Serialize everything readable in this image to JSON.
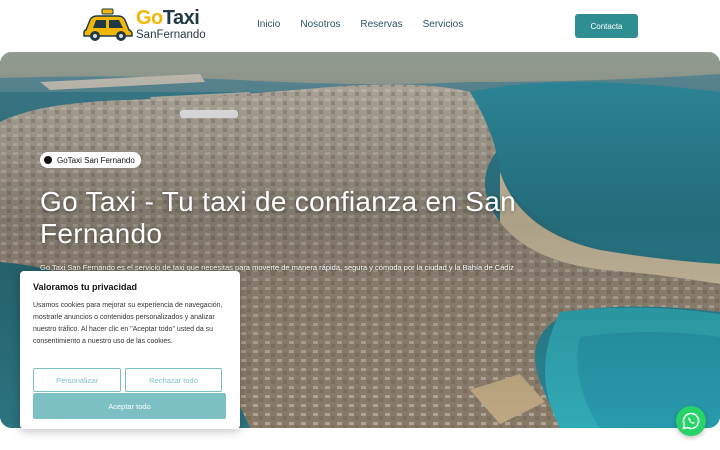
{
  "brand": {
    "go": "Go",
    "taxi": "Taxi",
    "city": "SanFernando",
    "colors": {
      "accent": "#2e8e91",
      "yellow": "#f2b705",
      "dark": "#1f3a45"
    }
  },
  "nav": {
    "items": [
      "Inicio",
      "Nosotros",
      "Reservas",
      "Servicios"
    ],
    "contact_label": "Contacta"
  },
  "hero": {
    "badge": "GoTaxi San Fernando",
    "title": "Go Taxi - Tu taxi de confianza en San Fernando",
    "subtitle": "Go Taxi San Fernando es el servicio de taxi que necesitas para moverte de manera rápida, segura y cómoda por la ciudad y la Bahía de Cádiz"
  },
  "cookie": {
    "title": "Valoramos tu privacidad",
    "text": "Usamos cookies para mejorar su experiencia de navegación, mostrarle anuncios o contenidos personalizados y analizar nuestro tráfico. Al hacer clic en \"Aceptar todo\" usted da su consentimiento a nuestro uso de las cookies.",
    "customize_label": "Personalizar",
    "reject_label": "Rechazar todo",
    "accept_label": "Aceptar todo",
    "color": "#7cc0c3"
  },
  "whatsapp": {
    "icon": "whatsapp-icon",
    "color": "#25d366"
  }
}
